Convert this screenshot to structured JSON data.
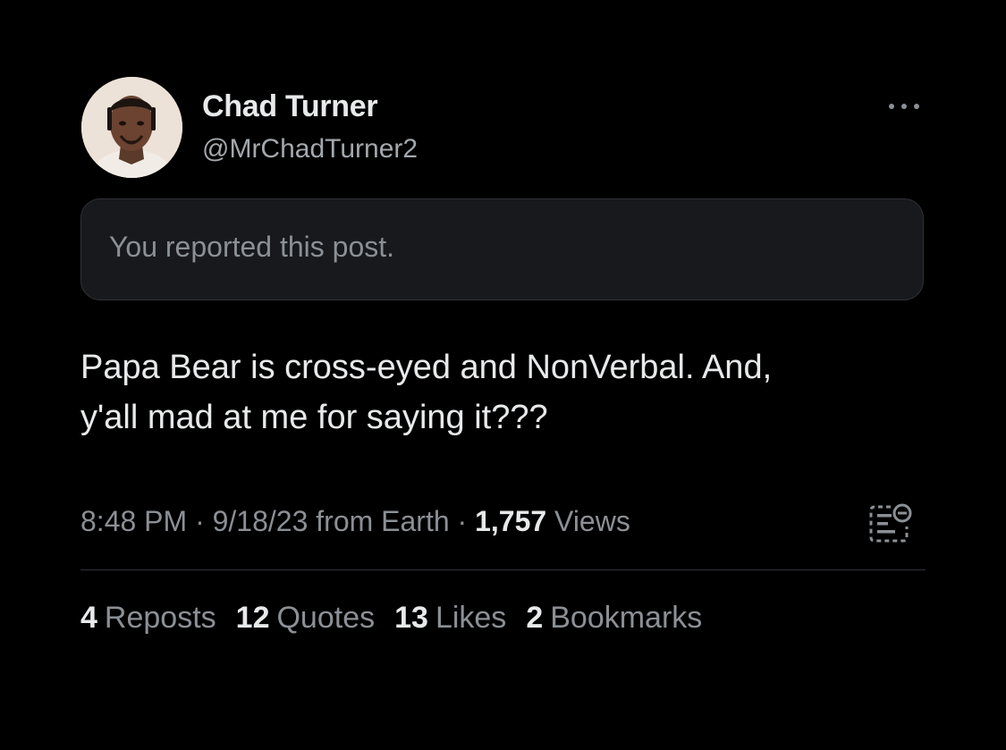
{
  "author": {
    "name": "Chad Turner",
    "handle": "@MrChadTurner2"
  },
  "notice": {
    "text": "You reported this post."
  },
  "post": {
    "lines": [
      "Papa Bear is cross-eyed and NonVerbal. And,",
      "y'all mad at me for saying it???"
    ]
  },
  "meta": {
    "time": "8:48 PM",
    "separator": "·",
    "date_source": "9/18/23 from Earth",
    "views_count": "1,757",
    "views_label": "Views"
  },
  "stats": [
    {
      "count": "4",
      "label": "Reposts"
    },
    {
      "count": "12",
      "label": "Quotes"
    },
    {
      "count": "13",
      "label": "Likes"
    },
    {
      "count": "2",
      "label": "Bookmarks"
    }
  ],
  "icons": {
    "more": "more-horizontal-icon",
    "analytics": "post-analytics-icon"
  },
  "colors": {
    "background": "#000000",
    "primary_text": "#e7e9ea",
    "secondary_text": "#8b9095",
    "notice_background": "#17191c",
    "border": "#2f3336"
  }
}
